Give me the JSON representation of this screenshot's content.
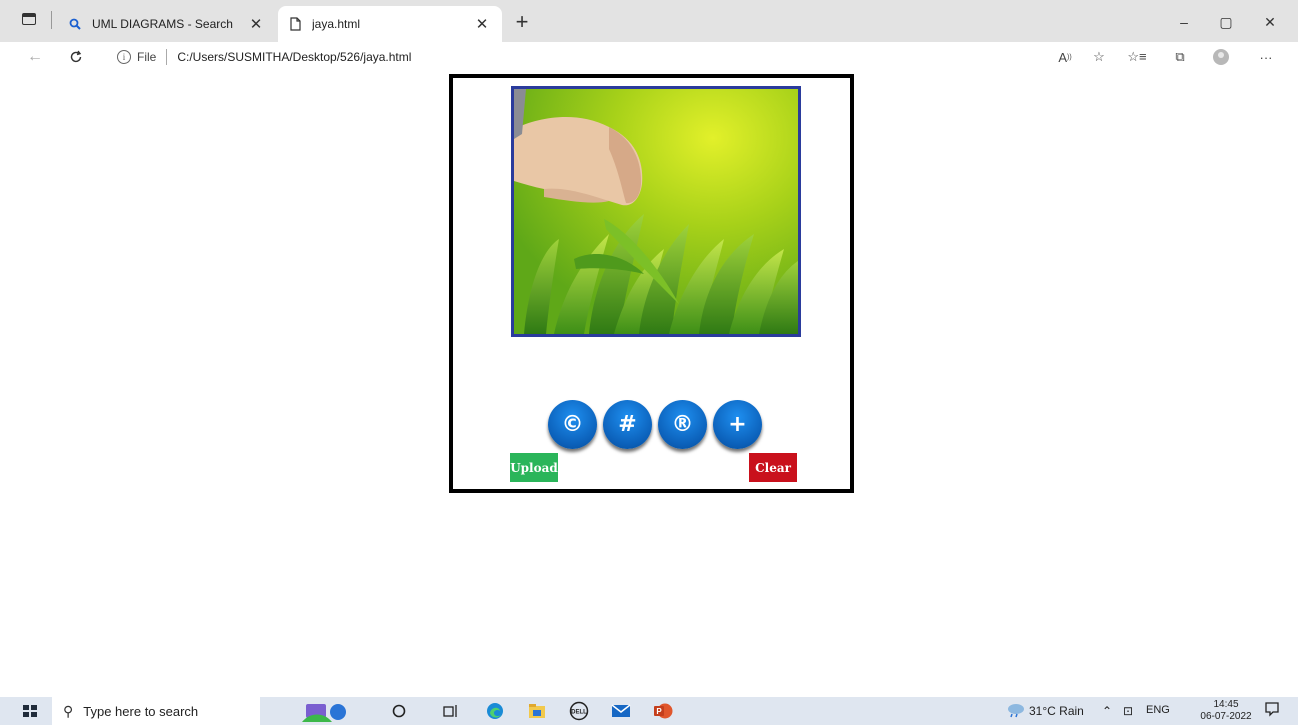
{
  "browser": {
    "tabs": [
      {
        "label": "UML DIAGRAMS - Search",
        "icon": "search-icon",
        "active": false
      },
      {
        "label": "jaya.html",
        "icon": "document-icon",
        "active": true
      }
    ],
    "new_tab_label": "+",
    "window_controls": {
      "minimize": "–",
      "restore": "▢",
      "close": "✕"
    },
    "address": {
      "file_label": "File",
      "url": "C:/Users/SUSMITHA/Desktop/526/jaya.html"
    },
    "toolbar_icons": [
      "read-aloud-icon",
      "add-favorite-icon",
      "favorites-icon",
      "collections-icon",
      "profile-avatar",
      "more-menu-icon"
    ],
    "more_label": "···"
  },
  "page": {
    "image_alt": "grass",
    "symbol_buttons": [
      {
        "symbol": "©",
        "name": "copyright-button"
      },
      {
        "symbol": "#",
        "name": "hash-button"
      },
      {
        "symbol": "®",
        "name": "registered-button"
      },
      {
        "symbol": "+",
        "name": "plus-button"
      }
    ],
    "upload_label": "Upload",
    "clear_label": "Clear",
    "colors": {
      "upload": "#2ab55a",
      "clear": "#c9111c",
      "symbol_button": "#0b5fb8",
      "image_border": "#2a3b9c"
    }
  },
  "taskbar": {
    "search_placeholder": "Type here to search",
    "weather": "31°C  Rain",
    "language": "ENG",
    "time": "14:45",
    "date": "06-07-2022"
  }
}
